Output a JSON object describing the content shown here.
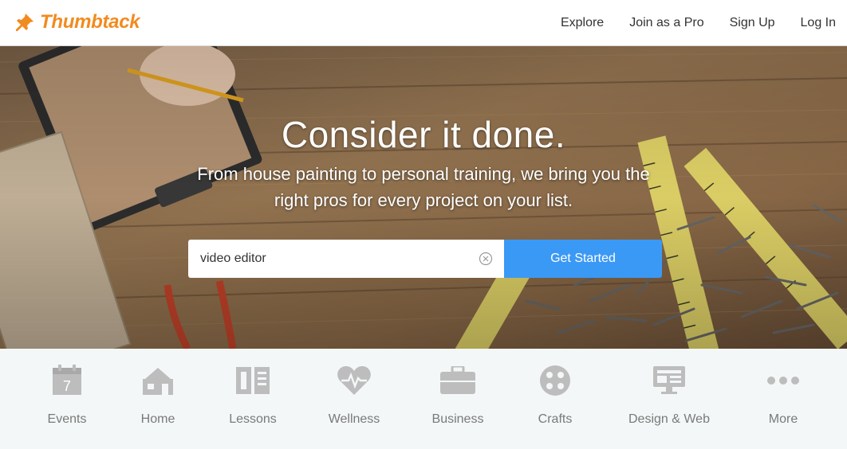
{
  "header": {
    "brand": "Thumbtack",
    "nav": [
      "Explore",
      "Join as a Pro",
      "Sign Up",
      "Log In"
    ]
  },
  "hero": {
    "title": "Consider it done.",
    "subtitle": "From house painting to personal training, we bring you the right pros for every project on your list.",
    "search_value": "video editor",
    "cta_label": "Get Started"
  },
  "categories": [
    {
      "label": "Events",
      "icon": "calendar-icon",
      "day": "7"
    },
    {
      "label": "Home",
      "icon": "house-icon"
    },
    {
      "label": "Lessons",
      "icon": "book-icon"
    },
    {
      "label": "Wellness",
      "icon": "heart-pulse-icon"
    },
    {
      "label": "Business",
      "icon": "briefcase-icon"
    },
    {
      "label": "Crafts",
      "icon": "palette-icon"
    },
    {
      "label": "Design & Web",
      "icon": "monitor-icon"
    },
    {
      "label": "More",
      "icon": "ellipsis-icon"
    }
  ],
  "colors": {
    "brand": "#f28b1f",
    "cta": "#3b99f6",
    "category_icon": "#bdbdbd",
    "category_text": "#7a7a7a",
    "category_bg": "#f3f7f7"
  }
}
